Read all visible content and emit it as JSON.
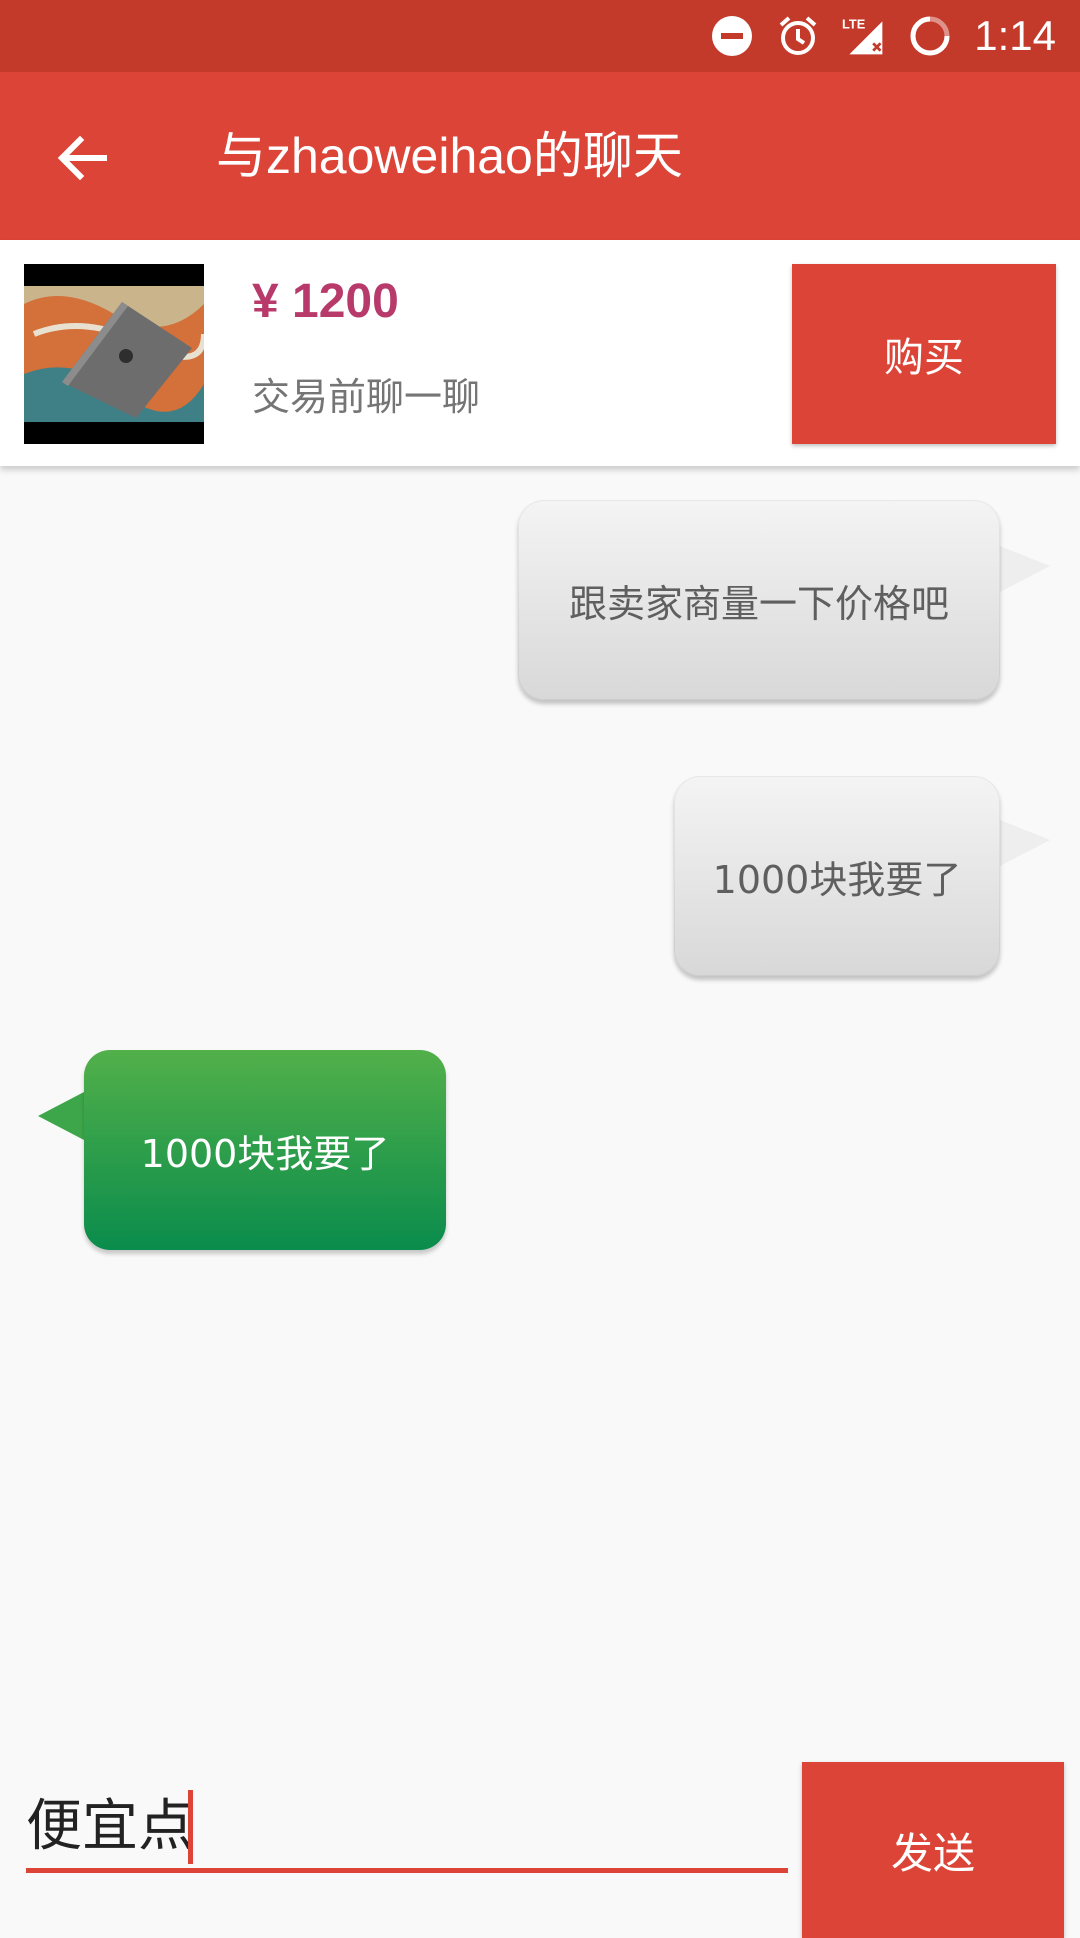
{
  "status_bar": {
    "time": "1:14",
    "icons": [
      "do-not-disturb-icon",
      "alarm-icon",
      "lte-signal-icon",
      "battery-icon"
    ]
  },
  "app_bar": {
    "title": "与zhaoweihao的聊天",
    "back_icon": "arrow-left-icon"
  },
  "product": {
    "price": "¥ 1200",
    "subtitle": "交易前聊一聊",
    "buy_label": "购买",
    "thumbnail": "laptop-photo"
  },
  "messages": [
    {
      "direction": "outgoing",
      "text": "跟卖家商量一下价格吧"
    },
    {
      "direction": "outgoing",
      "text": "1000块我要了"
    },
    {
      "direction": "incoming",
      "text": "1000块我要了"
    }
  ],
  "composer": {
    "value": "便宜点",
    "send_label": "发送"
  },
  "colors": {
    "status_bar": "#c3392a",
    "primary": "#dc4437",
    "price": "#b83a6b",
    "incoming_bubble": "#0a8c4c",
    "outgoing_bubble": "#e0e0e0"
  }
}
